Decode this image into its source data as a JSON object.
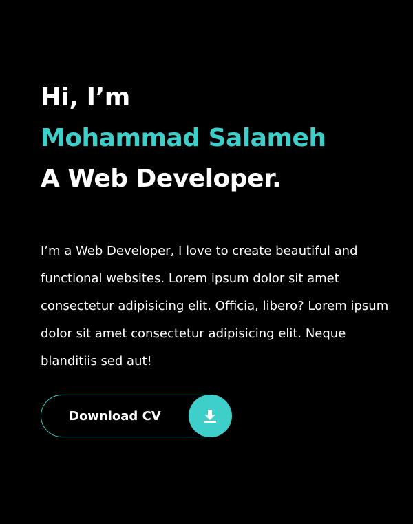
{
  "hero": {
    "greeting": "Hi, I’m",
    "name": "Mohammad Salameh",
    "role": "A Web Developer."
  },
  "bio": "I’m a Web Developer, I love to create beautiful and functional websites. Lorem ipsum dolor sit amet consectetur adipisicing elit. Officia, libero? Lorem ipsum dolor sit amet consectetur adipisicing elit. Neque blanditiis sed aut!",
  "cv_button": {
    "label": "Download CV",
    "icon": "download-icon"
  },
  "colors": {
    "background": "#000000",
    "accent": "#3ecfca",
    "text": "#ffffff"
  }
}
